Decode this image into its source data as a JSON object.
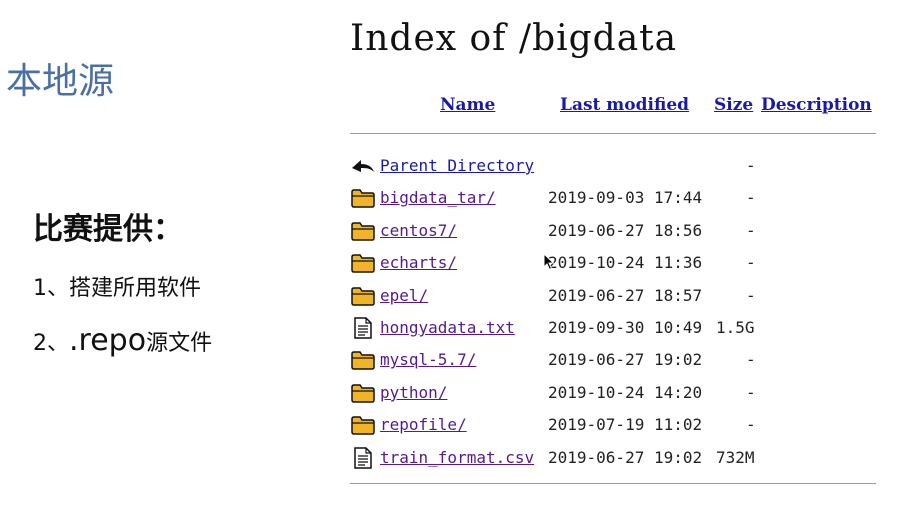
{
  "slide": {
    "title": "本地源",
    "heading": "比赛提供：",
    "point1": "1、搭建所用软件",
    "point2_prefix": "2、",
    "point2_big": ".repo",
    "point2_suffix": "源文件"
  },
  "listing": {
    "title": "Index of /bigdata",
    "headers": {
      "name": "Name",
      "last_modified": "Last modified",
      "size": "Size",
      "description": "Description"
    },
    "rows": [
      {
        "icon": "parent-directory-icon",
        "name": "Parent Directory",
        "date": "",
        "size": "-"
      },
      {
        "icon": "folder-icon",
        "name": "bigdata_tar/",
        "date": "2019-09-03 17:44",
        "size": "-"
      },
      {
        "icon": "folder-icon",
        "name": "centos7/",
        "date": "2019-06-27 18:56",
        "size": "-"
      },
      {
        "icon": "folder-icon",
        "name": "echarts/",
        "date": "2019-10-24 11:36",
        "size": "-"
      },
      {
        "icon": "folder-icon",
        "name": "epel/",
        "date": "2019-06-27 18:57",
        "size": "-"
      },
      {
        "icon": "text-file-icon",
        "name": "hongyadata.txt",
        "date": "2019-09-30 10:49",
        "size": "1.5G"
      },
      {
        "icon": "folder-icon",
        "name": "mysql-5.7/",
        "date": "2019-06-27 19:02",
        "size": "-"
      },
      {
        "icon": "folder-icon",
        "name": "python/",
        "date": "2019-10-24 14:20",
        "size": "-"
      },
      {
        "icon": "folder-icon",
        "name": "repofile/",
        "date": "2019-07-19 11:02",
        "size": "-"
      },
      {
        "icon": "text-file-icon",
        "name": "train_format.csv",
        "date": "2019-06-27 19:02",
        "size": "732M"
      }
    ]
  },
  "colors": {
    "title_blue": "#4a6fa5",
    "link": "#1a1aa6",
    "visited_link": "#551a8b",
    "folder": "#e8a317"
  }
}
